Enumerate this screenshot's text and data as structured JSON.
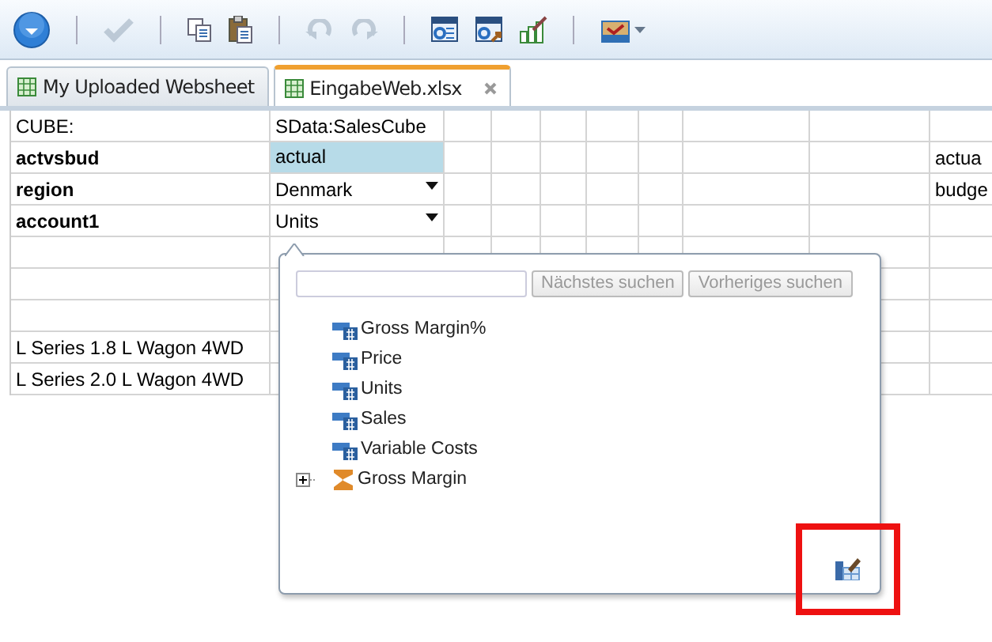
{
  "toolbar": [
    {
      "kind": "menu",
      "disabled": false
    },
    {
      "kind": "separator"
    },
    {
      "kind": "confirm",
      "disabled": true
    },
    {
      "kind": "separator"
    },
    {
      "kind": "copy",
      "disabled": false
    },
    {
      "kind": "paste",
      "disabled": false
    },
    {
      "kind": "separator"
    },
    {
      "kind": "undo",
      "disabled": true
    },
    {
      "kind": "redo",
      "disabled": true
    },
    {
      "kind": "separator"
    },
    {
      "kind": "refresh-sheet",
      "disabled": false
    },
    {
      "kind": "refresh-all",
      "disabled": false
    },
    {
      "kind": "chart",
      "disabled": false
    },
    {
      "kind": "separator"
    },
    {
      "kind": "export",
      "disabled": false
    }
  ],
  "tabs": [
    {
      "label": "My Uploaded Websheet",
      "selected": false,
      "closable": false
    },
    {
      "label": "EingabeWeb.xlsx",
      "selected": true,
      "closable": true
    }
  ],
  "sheet": {
    "rows": [
      {
        "label": "CUBE:",
        "bold": false,
        "value": "SData:SalesCube",
        "selected": false,
        "dropdown": false
      },
      {
        "label": "actvsbud",
        "bold": true,
        "value": "actual",
        "selected": true,
        "dropdown": false,
        "column_10": "actua"
      },
      {
        "label": "region",
        "bold": true,
        "value": "Denmark",
        "selected": false,
        "dropdown": true,
        "column_10": "budge"
      },
      {
        "label": "account1",
        "bold": true,
        "value": "Units",
        "selected": false,
        "dropdown": true
      },
      {},
      {},
      {},
      {
        "label": "L Series 1.8 L Wagon 4WD",
        "bold": false
      },
      {
        "label": "L Series 2.0 L Wagon 4WD",
        "bold": false
      }
    ]
  },
  "popup": {
    "buttons": [
      {
        "label": "Nächstes suchen",
        "disabled": true
      },
      {
        "label": "Vorheriges suchen",
        "disabled": true
      }
    ],
    "tree": [
      {
        "label": "Gross Margin%",
        "kind": "measure"
      },
      {
        "label": "Price",
        "kind": "measure"
      },
      {
        "label": "Units",
        "kind": "measure"
      },
      {
        "label": "Sales",
        "kind": "measure"
      },
      {
        "label": "Variable Costs",
        "kind": "measure"
      },
      {
        "label": "Gross Margin",
        "kind": "sum",
        "expanded": false
      }
    ]
  }
}
